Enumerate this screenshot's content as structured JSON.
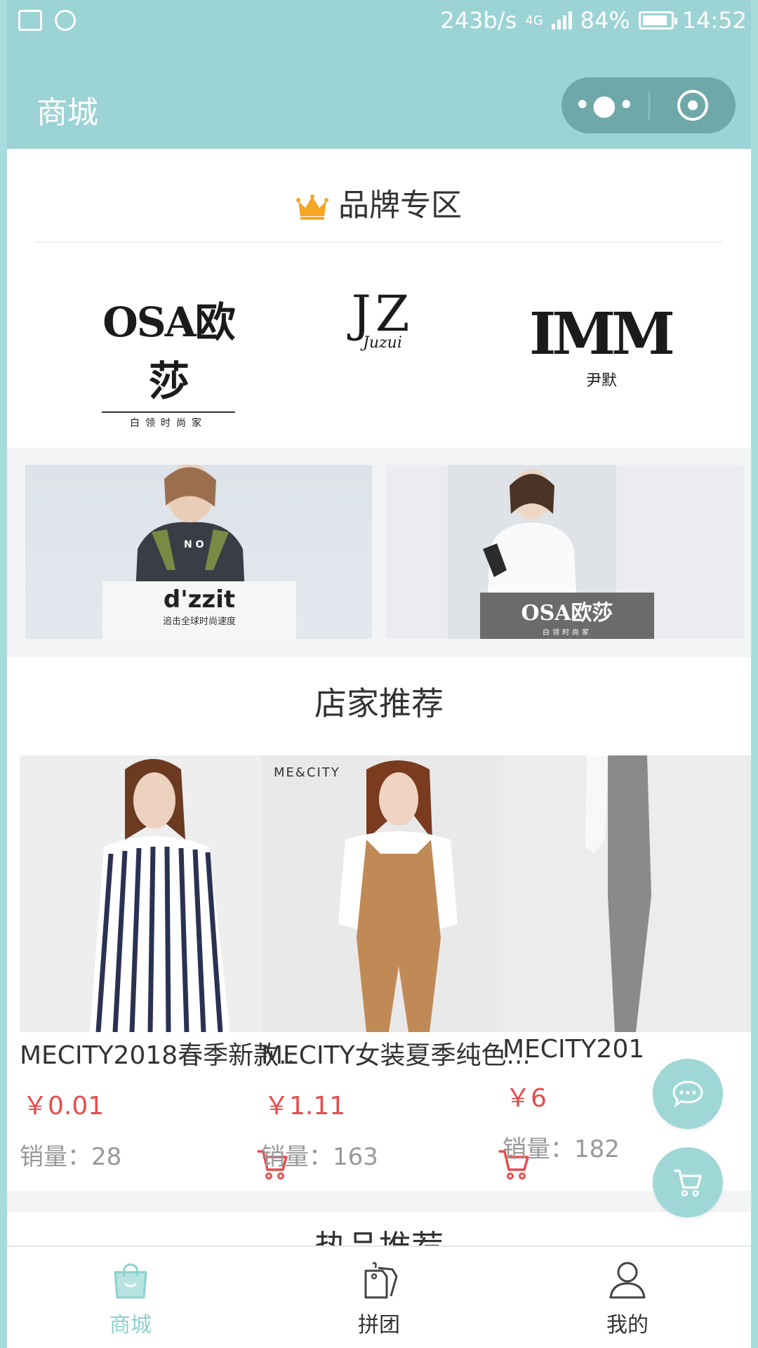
{
  "status_bar": {
    "speed": "243b/s",
    "network": "4G",
    "battery": "84%",
    "time": "14:52"
  },
  "header": {
    "title": "商城"
  },
  "brand_zone": {
    "title": "品牌专区",
    "logos": [
      {
        "main": "OSA欧莎",
        "sub": "白领时尚家"
      },
      {
        "main": "JZ",
        "sub": "Juzui"
      },
      {
        "main": "IMM",
        "sub": "尹默"
      }
    ]
  },
  "banners": [
    {
      "brand": "d'zzit",
      "slogan": "追击全球时尚速度"
    },
    {
      "brand": "OSA欧莎",
      "slogan": "白领时尚家"
    }
  ],
  "shop_recommend": {
    "title": "店家推荐",
    "products": [
      {
        "name": "MECITY2018春季新款..",
        "price": "￥0.01",
        "sales": "销量：28"
      },
      {
        "name": "MECITY女装夏季纯色...",
        "price": "￥1.11",
        "sales": "销量：163",
        "watermark": "ME&CITY"
      },
      {
        "name": "MECITY201",
        "price": "￥6",
        "sales": "销量：182"
      }
    ]
  },
  "hot_recommend": {
    "title": "热品推荐"
  },
  "tabbar": {
    "items": [
      {
        "label": "商城",
        "icon": "shopping-bag-icon"
      },
      {
        "label": "拼团",
        "icon": "tag-icon"
      },
      {
        "label": "我的",
        "icon": "user-icon"
      }
    ]
  },
  "colors": {
    "accent": "#9cd3d4",
    "price": "#e94b4b",
    "active_tab": "#8ed0d0"
  }
}
